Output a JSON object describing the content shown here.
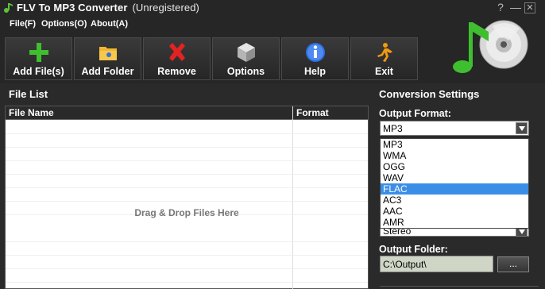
{
  "window": {
    "title": "FLV To MP3 Converter",
    "status": "(Unregistered)",
    "help_glyph": "?",
    "min_glyph": "—",
    "close_glyph": "✕"
  },
  "menu": {
    "items": [
      {
        "label": "File(F)"
      },
      {
        "label": "Options(O)"
      },
      {
        "label": "About(A)"
      }
    ]
  },
  "toolbar": {
    "buttons": [
      {
        "label": "Add File(s)",
        "icon": "plus-icon"
      },
      {
        "label": "Add Folder",
        "icon": "folder-icon"
      },
      {
        "label": "Remove",
        "icon": "remove-x-icon"
      },
      {
        "label": "Options",
        "icon": "cube-icon"
      },
      {
        "label": "Help",
        "icon": "info-icon"
      },
      {
        "label": "Exit",
        "icon": "exit-runner-icon"
      }
    ]
  },
  "file_list": {
    "title": "File List",
    "columns": [
      "File Name",
      "Format"
    ],
    "drop_hint": "Drag & Drop Files Here"
  },
  "conversion": {
    "title": "Conversion Settings",
    "output_format_label": "Output Format:",
    "output_format_value": "MP3",
    "format_options": [
      "MP3",
      "WMA",
      "OGG",
      "WAV",
      "FLAC",
      "AC3",
      "AAC",
      "AMR"
    ],
    "highlighted_option": "FLAC",
    "channel_value": "Stereo",
    "output_folder_label": "Output Folder:",
    "output_folder_value": "C:\\Output\\",
    "browse_label": "..."
  },
  "colors": {
    "background": "#262626",
    "selection": "#3a8ee6"
  }
}
